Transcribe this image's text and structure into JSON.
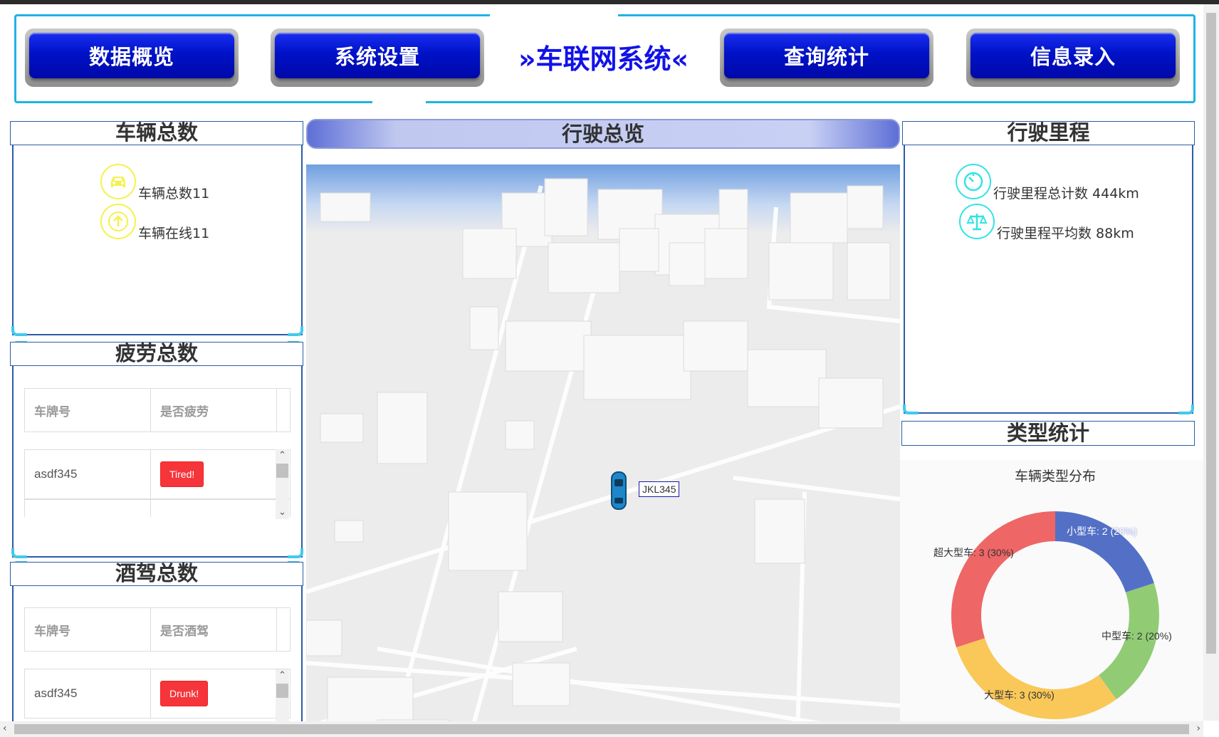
{
  "nav": {
    "buttons": [
      "数据概览",
      "系统设置",
      "查询统计",
      "信息录入"
    ],
    "app_title": "»车联网系统«"
  },
  "vehicle_total": {
    "title": "车辆总数",
    "total_label": "车辆总数11",
    "online_label": "车辆在线11"
  },
  "fatigue": {
    "title": "疲劳总数",
    "columns": [
      "车牌号",
      "是否疲劳"
    ],
    "rows": [
      {
        "plate": "asdf345",
        "status": "Tired!"
      }
    ]
  },
  "drunk": {
    "title": "酒驾总数",
    "columns": [
      "车牌号",
      "是否酒驾"
    ],
    "rows": [
      {
        "plate": "asdf345",
        "status": "Drunk!"
      }
    ]
  },
  "overview": {
    "title": "行驶总览",
    "vehicle_marker": "JKL345"
  },
  "mileage": {
    "title": "行驶里程",
    "total_label": "行驶里程总计数 444km",
    "avg_label": "行驶里程平均数 88km"
  },
  "type_stats": {
    "title": "类型统计"
  },
  "chart_data": {
    "type": "pie",
    "title": "车辆类型分布",
    "slices": [
      {
        "name": "小型车",
        "value": 2,
        "percent": "20%",
        "label": "小型车: 2 (20%)",
        "color": "#5470c6"
      },
      {
        "name": "中型车",
        "value": 2,
        "percent": "20%",
        "label": "中型车: 2 (20%)",
        "color": "#91cc75"
      },
      {
        "name": "大型车",
        "value": 3,
        "percent": "30%",
        "label": "大型车: 3 (30%)",
        "color": "#fac858"
      },
      {
        "name": "超大型车",
        "value": 3,
        "percent": "30%",
        "label": "超大型车: 3 (30%)",
        "color": "#ee6666"
      }
    ],
    "donut": true,
    "legend": "none"
  },
  "colors": {
    "nav_blue": "#0012c8",
    "title_blue": "#1212e8",
    "panel_border": "#2a5da8",
    "corner_cyan": "#42c9ee",
    "badge_red": "#f5353a"
  }
}
